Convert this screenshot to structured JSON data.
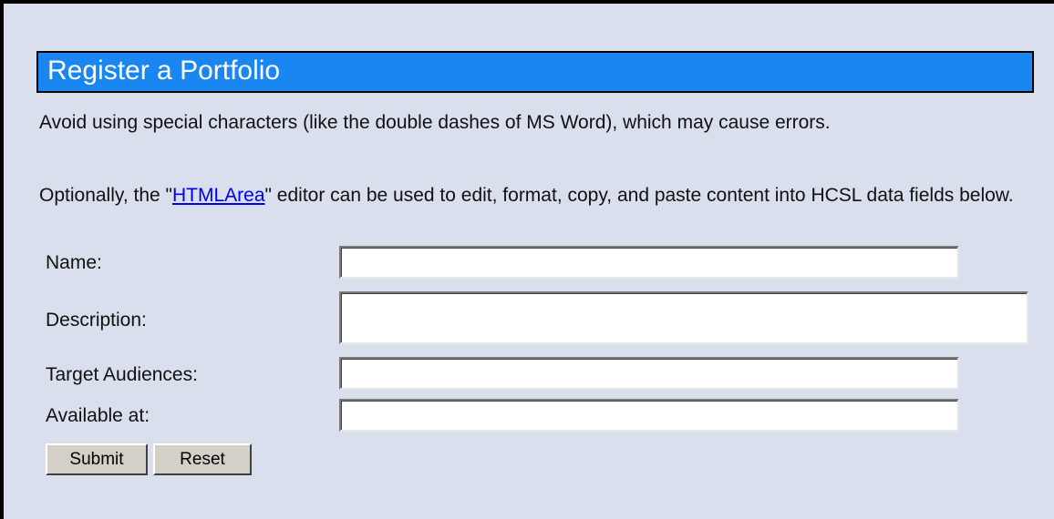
{
  "page": {
    "title": "Register a Portfolio"
  },
  "intro": {
    "warning": "Avoid using special characters (like the double dashes of MS Word), which may cause errors.",
    "optional_prefix": "Optionally, the \"",
    "editor_link": "HTMLArea",
    "optional_suffix": "\" editor can be used to edit, format, copy, and paste content into HCSL data fields below."
  },
  "form": {
    "fields": [
      {
        "label": "Name:",
        "value": ""
      },
      {
        "label": "Description:",
        "value": ""
      },
      {
        "label": "Target Audiences:",
        "value": ""
      },
      {
        "label": "Available at:",
        "value": ""
      }
    ],
    "submit_label": "Submit",
    "reset_label": "Reset"
  },
  "colors": {
    "background": "#d9dfec",
    "title_bar": "#1a86f2",
    "title_text": "#ffffff",
    "link": "#0000ee"
  }
}
